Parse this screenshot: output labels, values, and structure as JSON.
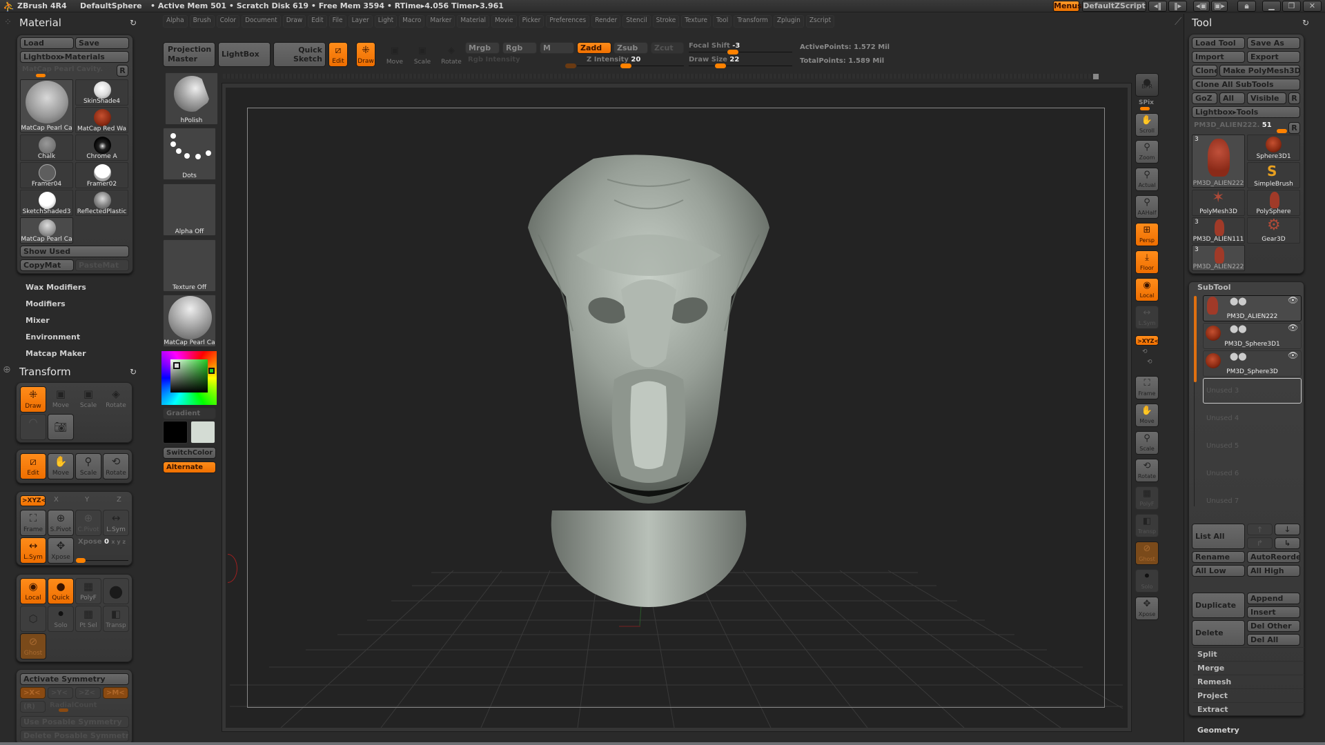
{
  "titlebar": {
    "app": "ZBrush 4R4",
    "doc": "DefaultSphere",
    "stats": "• Active Mem 501 • Scratch Disk 619 • Free Mem 3594 • RTime▸4.056  Timer▸3.961",
    "menus_button": "Menus",
    "script_button": "DefaultZScript",
    "icons": [
      "scroll-left-icon",
      "scroll-right-icon",
      "layout-prev-icon",
      "layout-next-icon",
      "lock-icon",
      "minimize-icon",
      "restore-icon",
      "close-icon"
    ]
  },
  "menubar": [
    "Alpha",
    "Brush",
    "Color",
    "Document",
    "Draw",
    "Edit",
    "File",
    "Layer",
    "Light",
    "Macro",
    "Marker",
    "Material",
    "Movie",
    "Picker",
    "Preferences",
    "Render",
    "Stencil",
    "Stroke",
    "Texture",
    "Tool",
    "Transform",
    "Zplugin",
    "Zscript"
  ],
  "toolbar": {
    "projection_master": "Projection Master",
    "lightbox": "LightBox",
    "quick_sketch": "Quick Sketch",
    "edit": "Edit",
    "draw": "Draw",
    "move": "Move",
    "scale": "Scale",
    "rotate": "Rotate",
    "mrgb": "Mrgb",
    "rgb": "Rgb",
    "m": "M",
    "zadd": "Zadd",
    "zsub": "Zsub",
    "zcut": "Zcut",
    "rgb_intensity_label": "Rgb Intensity",
    "z_intensity_label": "Z Intensity",
    "z_intensity_value": "20",
    "focal_shift_label": "Focal Shift",
    "focal_shift_value": "-3",
    "draw_size_label": "Draw Size",
    "draw_size_value": "22",
    "active_points": "ActivePoints: 1.572 Mil",
    "total_points": "TotalPoints: 1.589 Mil"
  },
  "material_panel": {
    "title": "Material",
    "load": "Load",
    "save": "Save",
    "lightbox": "Lightbox▸Materials",
    "current": "MatCap Pearl Cavity.",
    "r": "R",
    "items": [
      "MatCap Pearl Ca",
      "SkinShade4",
      "MatCap Red Wa",
      "Chalk",
      "Chrome A",
      "Framer04",
      "Framer02",
      "SketchShaded3",
      "ReflectedPlastic",
      "MatCap Pearl Ca"
    ],
    "show_used": "Show Used",
    "copymat": "CopyMat",
    "pastemat": "PasteMat",
    "subsections": [
      "Wax Modifiers",
      "Modifiers",
      "Mixer",
      "Environment",
      "Matcap Maker"
    ]
  },
  "transform_panel": {
    "title": "Transform",
    "row1": [
      "Draw",
      "Move",
      "Scale",
      "Rotate"
    ],
    "edit_label": "Edit",
    "row2": [
      "Edit",
      "Move",
      "Scale",
      "Rotate"
    ],
    "axes": [
      ">XYZ<",
      "X",
      "Y",
      "Z"
    ],
    "row3": [
      "Frame",
      "S.Pivot",
      "C.Pivot",
      "L.Sym"
    ],
    "row4": [
      "L.Sym",
      "Xpose"
    ],
    "xpose_label": "Xpose",
    "xpose_value": "0",
    "xyz_small": "x y z",
    "row5": [
      "Local",
      "Quick",
      "PolyF",
      ""
    ],
    "row6": [
      "",
      "Solo",
      "Pt Sel",
      "Transp"
    ],
    "ghost": "Ghost",
    "activate_symmetry": "Activate Symmetry",
    "sym_axes": [
      ">X<",
      ">Y<",
      ">Z<",
      ">M<"
    ],
    "r_paren": "(R)",
    "radial_count": "RadialCount",
    "use_posable": "Use Posable Symmetry",
    "delete_posable": "Delete Posable Symmetry"
  },
  "left_shelf": {
    "brush": "hPolish",
    "stroke": "Dots",
    "alpha": "Alpha Off",
    "texture": "Texture Off",
    "material": "MatCap Pearl Ca",
    "gradient": "Gradient",
    "switch_color": "SwitchColor",
    "alternate": "Alternate",
    "main_color": "#000000",
    "secondary_color": "#d4dcd4",
    "picked_hue": "#22cc22"
  },
  "right_shelf": [
    {
      "label": "BPR",
      "state": "normal"
    },
    {
      "label": "SPix",
      "state": "label"
    },
    {
      "label": "Scroll",
      "state": "normal"
    },
    {
      "label": "Zoom",
      "state": "normal"
    },
    {
      "label": "Actual",
      "state": "normal"
    },
    {
      "label": "AAHalf",
      "state": "normal"
    },
    {
      "label": "Persp",
      "state": "orange"
    },
    {
      "label": "Floor",
      "state": "orange"
    },
    {
      "label": "Local",
      "state": "orange"
    },
    {
      "label": "L.Sym",
      "state": "dis"
    },
    {
      "label": ">XYZ<",
      "state": "orange"
    },
    {
      "label": "Frame",
      "state": "normal"
    },
    {
      "label": "Move",
      "state": "normal"
    },
    {
      "label": "Scale",
      "state": "normal"
    },
    {
      "label": "Rotate",
      "state": "normal"
    },
    {
      "label": "PolyF",
      "state": "dis"
    },
    {
      "label": "Transp",
      "state": "dis"
    },
    {
      "label": "Ghost",
      "state": "ghost"
    },
    {
      "label": "Solo",
      "state": "dis"
    },
    {
      "label": "Xpose",
      "state": "normal"
    }
  ],
  "tool_panel": {
    "title": "Tool",
    "load_tool": "Load Tool",
    "save_as": "Save As",
    "import": "Import",
    "export": "Export",
    "clone": "Clone",
    "make_polymesh": "Make PolyMesh3D",
    "clone_all": "Clone All SubTools",
    "goz": "GoZ",
    "all": "All",
    "visible": "Visible",
    "r": "R",
    "lightbox": "Lightbox▸Tools",
    "current_tool": "PM3D_ALIEN222.",
    "current_value": "51",
    "tools": [
      {
        "name": "PM3D_ALIEN222",
        "badge": "3"
      },
      {
        "name": "Sphere3D1",
        "badge": ""
      },
      {
        "name": "SimpleBrush",
        "badge": ""
      },
      {
        "name": "PolyMesh3D",
        "badge": ""
      },
      {
        "name": "PolySphere",
        "badge": ""
      },
      {
        "name": "PM3D_ALIEN111",
        "badge": "3"
      },
      {
        "name": "Gear3D",
        "badge": ""
      },
      {
        "name": "PM3D_ALIEN222",
        "badge": "3"
      }
    ]
  },
  "subtool_panel": {
    "title": "SubTool",
    "items": [
      "PM3D_ALIEN222",
      "PM3D_Sphere3D1",
      "PM3D_Sphere3D"
    ],
    "unused": [
      "Unused 3",
      "Unused 4",
      "Unused 5",
      "Unused 6",
      "Unused 7"
    ],
    "list_all": "List All",
    "rename": "Rename",
    "autoreorder": "AutoReorder",
    "all_low": "All Low",
    "all_high": "All High",
    "duplicate": "Duplicate",
    "append": "Append",
    "insert": "Insert",
    "delete": "Delete",
    "del_other": "Del Other",
    "del_all": "Del All",
    "sections": [
      "Split",
      "Merge",
      "Remesh",
      "Project",
      "Extract"
    ],
    "geometry": "Geometry"
  }
}
